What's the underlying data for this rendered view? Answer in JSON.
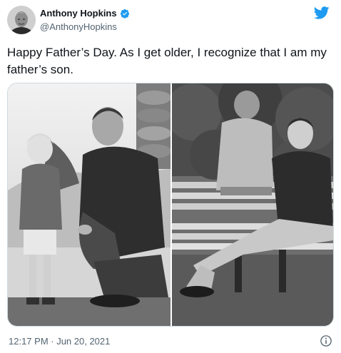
{
  "tweet": {
    "author": {
      "name": "Anthony Hopkins",
      "handle": "@AnthonyHopkins",
      "verified": true,
      "avatar_icon": "profile-photo-avatar"
    },
    "text": "Happy Father’s Day. As I get older, I recognize that I am my father’s son.",
    "media": {
      "photos": [
        {
          "icon": "photo-man-crouching-with-child"
        },
        {
          "icon": "photo-man-sitting-on-bench"
        }
      ],
      "style": "black-and-white"
    },
    "timestamp": "12:17 PM · Jun 20, 2021"
  },
  "icons": {
    "brand": "twitter-bird-icon",
    "verified": "verified-badge-icon",
    "info": "info-icon"
  },
  "colors": {
    "brand_blue": "#1d9bf0",
    "text_primary": "#0f1419",
    "text_secondary": "#536471",
    "border": "#cfd9de"
  }
}
